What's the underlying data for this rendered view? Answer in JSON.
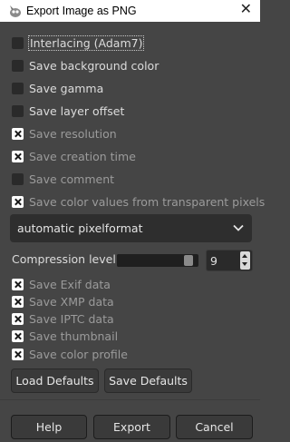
{
  "window": {
    "title": "Export Image as PNG",
    "icon": "gimp-icon",
    "close": "✕"
  },
  "options": [
    {
      "label": "Interlacing (Adam7)",
      "checked": false,
      "enabled": true
    },
    {
      "label": "Save background color",
      "checked": false,
      "enabled": true
    },
    {
      "label": "Save gamma",
      "checked": false,
      "enabled": true
    },
    {
      "label": "Save layer offset",
      "checked": false,
      "enabled": true
    },
    {
      "label": "Save resolution",
      "checked": true,
      "enabled": false
    },
    {
      "label": "Save creation time",
      "checked": true,
      "enabled": false
    },
    {
      "label": "Save comment",
      "checked": false,
      "enabled": false
    },
    {
      "label": "Save color values from transparent pixels",
      "checked": true,
      "enabled": false
    }
  ],
  "pixelformat": {
    "selected": "automatic pixelformat"
  },
  "compression": {
    "label": "Compression level:",
    "value": "9",
    "fraction": 0.95
  },
  "metadata": [
    {
      "label": "Save Exif data",
      "checked": true
    },
    {
      "label": "Save XMP data",
      "checked": true
    },
    {
      "label": "Save IPTC data",
      "checked": true
    },
    {
      "label": "Save thumbnail",
      "checked": true
    },
    {
      "label": "Save color profile",
      "checked": true
    }
  ],
  "buttons": {
    "load_defaults": "Load Defaults",
    "save_defaults": "Save Defaults",
    "help": "Help",
    "export": "Export",
    "cancel": "Cancel"
  }
}
